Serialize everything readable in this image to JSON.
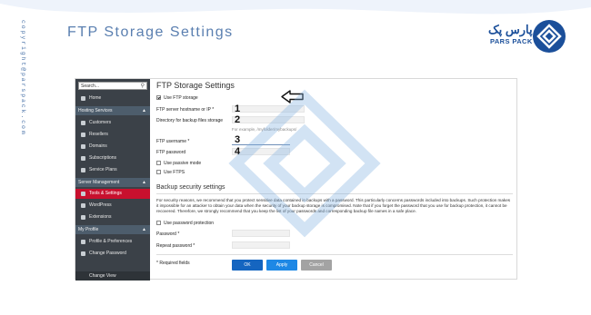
{
  "slide": {
    "title": "FTP Storage Settings",
    "copyright": "copyright@parspack.com",
    "brand_fa": "پارس پک",
    "brand_en": "PARS PACK"
  },
  "sidebar": {
    "search_placeholder": "Search...",
    "home": "Home",
    "sections": [
      {
        "label": "Hosting Services",
        "items": [
          "Customers",
          "Resellers",
          "Domains",
          "Subscriptions",
          "Service Plans"
        ]
      },
      {
        "label": "Server Management",
        "items": [
          "Tools & Settings",
          "WordPress",
          "Extensions"
        ]
      },
      {
        "label": "My Profile",
        "items": [
          "Profile & Preferences",
          "Change Password"
        ]
      }
    ],
    "active_item": "Tools & Settings",
    "change_view": "Change View"
  },
  "form": {
    "title": "FTP Storage Settings",
    "use_ftp_storage": "Use FTP storage",
    "ftp_host_label": "FTP server hostname or IP *",
    "dir_label": "Directory for backup files storage",
    "dir_hint": "For example, /myfolder/mybackups/",
    "username_label": "FTP username *",
    "password_label": "FTP password",
    "passive_mode": "Use passive mode",
    "use_ftps": "Use FTPS",
    "security_heading": "Backup security settings",
    "security_text": "For security reasons, we recommend that you protect sensitive data contained in backups with a password. This particularly concerns passwords included into backups. Such protection makes it impossible for an attacker to obtain your data when the security of your backup storage is compromised. Note that if you forget the password that you use for backup protection, it cannot be recovered. Therefore, we strongly recommend that you keep the list of your passwords and corresponding backup file names in a safe place.",
    "use_password_protection": "Use password protection",
    "password_star_label": "Password *",
    "repeat_password_label": "Repeat password *",
    "required_fields": "* Required fields",
    "ok": "OK",
    "apply": "Apply",
    "cancel": "Cancel"
  },
  "annotations": {
    "n1": "1",
    "n2": "2",
    "n3": "3",
    "n4": "4"
  },
  "colors": {
    "accent": "#1565c0",
    "sidebar_bg": "#3b4148",
    "active": "#c8102e",
    "brand": "#1b4f9a"
  }
}
